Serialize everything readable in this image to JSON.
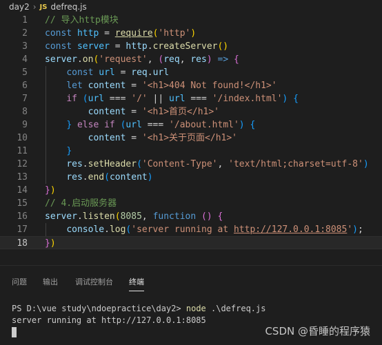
{
  "breadcrumb": {
    "folder": "day2",
    "sep": "›",
    "file_icon": "JS",
    "file": "defreq.js"
  },
  "editor": {
    "active_line": 18,
    "lines": [
      {
        "n": "1",
        "tokens": [
          {
            "t": "// 导入http模块",
            "c": "c-com"
          }
        ]
      },
      {
        "n": "2",
        "tokens": [
          {
            "t": "const ",
            "c": "c-kw"
          },
          {
            "t": "http",
            "c": "c-var"
          },
          {
            "t": " = ",
            "c": ""
          },
          {
            "t": "require",
            "c": "c-fn u"
          },
          {
            "t": "(",
            "c": "c-br1"
          },
          {
            "t": "'http'",
            "c": "c-str"
          },
          {
            "t": ")",
            "c": "c-br1"
          }
        ]
      },
      {
        "n": "3",
        "tokens": [
          {
            "t": "const ",
            "c": "c-kw"
          },
          {
            "t": "server",
            "c": "c-var"
          },
          {
            "t": " = ",
            "c": ""
          },
          {
            "t": "http",
            "c": "c-prop"
          },
          {
            "t": ".",
            "c": ""
          },
          {
            "t": "createServer",
            "c": "c-fn"
          },
          {
            "t": "()",
            "c": "c-br1"
          }
        ]
      },
      {
        "n": "4",
        "tokens": [
          {
            "t": "server",
            "c": "c-prop"
          },
          {
            "t": ".",
            "c": ""
          },
          {
            "t": "on",
            "c": "c-fn"
          },
          {
            "t": "(",
            "c": "c-br1"
          },
          {
            "t": "'request'",
            "c": "c-str"
          },
          {
            "t": ", ",
            "c": ""
          },
          {
            "t": "(",
            "c": "c-br2"
          },
          {
            "t": "req",
            "c": "c-prop"
          },
          {
            "t": ", ",
            "c": ""
          },
          {
            "t": "res",
            "c": "c-prop"
          },
          {
            "t": ")",
            "c": "c-br2"
          },
          {
            "t": " ",
            "c": ""
          },
          {
            "t": "=>",
            "c": "c-kw"
          },
          {
            "t": " ",
            "c": ""
          },
          {
            "t": "{",
            "c": "c-br2"
          }
        ]
      },
      {
        "n": "5",
        "tokens": [
          {
            "t": "    ",
            "c": ""
          },
          {
            "t": "const ",
            "c": "c-kw"
          },
          {
            "t": "url",
            "c": "c-var"
          },
          {
            "t": " = ",
            "c": ""
          },
          {
            "t": "req",
            "c": "c-prop"
          },
          {
            "t": ".",
            "c": ""
          },
          {
            "t": "url",
            "c": "c-prop"
          }
        ]
      },
      {
        "n": "6",
        "tokens": [
          {
            "t": "    ",
            "c": ""
          },
          {
            "t": "let ",
            "c": "c-kw"
          },
          {
            "t": "content",
            "c": "c-prop"
          },
          {
            "t": " = ",
            "c": ""
          },
          {
            "t": "'<h1>404 Not found!</h1>'",
            "c": "c-str"
          }
        ]
      },
      {
        "n": "7",
        "tokens": [
          {
            "t": "    ",
            "c": ""
          },
          {
            "t": "if ",
            "c": "c-ctl"
          },
          {
            "t": "(",
            "c": "c-br3"
          },
          {
            "t": "url",
            "c": "c-var"
          },
          {
            "t": " === ",
            "c": ""
          },
          {
            "t": "'/'",
            "c": "c-str"
          },
          {
            "t": " || ",
            "c": ""
          },
          {
            "t": "url",
            "c": "c-var"
          },
          {
            "t": " === ",
            "c": ""
          },
          {
            "t": "'/index.html'",
            "c": "c-str"
          },
          {
            "t": ")",
            "c": "c-br3"
          },
          {
            "t": " ",
            "c": ""
          },
          {
            "t": "{",
            "c": "c-br3"
          }
        ]
      },
      {
        "n": "8",
        "tokens": [
          {
            "t": "        ",
            "c": ""
          },
          {
            "t": "content",
            "c": "c-prop"
          },
          {
            "t": " = ",
            "c": ""
          },
          {
            "t": "'<h1>首页</h1>'",
            "c": "c-str"
          }
        ]
      },
      {
        "n": "9",
        "tokens": [
          {
            "t": "    ",
            "c": ""
          },
          {
            "t": "}",
            "c": "c-br3"
          },
          {
            "t": " ",
            "c": ""
          },
          {
            "t": "else ",
            "c": "c-ctl"
          },
          {
            "t": "if ",
            "c": "c-ctl"
          },
          {
            "t": "(",
            "c": "c-br3"
          },
          {
            "t": "url",
            "c": "c-var"
          },
          {
            "t": " === ",
            "c": ""
          },
          {
            "t": "'/about.html'",
            "c": "c-str"
          },
          {
            "t": ")",
            "c": "c-br3"
          },
          {
            "t": " ",
            "c": ""
          },
          {
            "t": "{",
            "c": "c-br3"
          }
        ]
      },
      {
        "n": "10",
        "tokens": [
          {
            "t": "        ",
            "c": ""
          },
          {
            "t": "content",
            "c": "c-prop"
          },
          {
            "t": " = ",
            "c": ""
          },
          {
            "t": "'<h1>关于页面</h1>'",
            "c": "c-str"
          }
        ]
      },
      {
        "n": "11",
        "tokens": [
          {
            "t": "    ",
            "c": ""
          },
          {
            "t": "}",
            "c": "c-br3"
          }
        ]
      },
      {
        "n": "12",
        "tokens": [
          {
            "t": "    ",
            "c": ""
          },
          {
            "t": "res",
            "c": "c-prop"
          },
          {
            "t": ".",
            "c": ""
          },
          {
            "t": "setHeader",
            "c": "c-fn"
          },
          {
            "t": "(",
            "c": "c-br3"
          },
          {
            "t": "'Content-Type'",
            "c": "c-str"
          },
          {
            "t": ", ",
            "c": ""
          },
          {
            "t": "'text/html;charset=utf-8'",
            "c": "c-str"
          },
          {
            "t": ")",
            "c": "c-br3"
          }
        ]
      },
      {
        "n": "13",
        "tokens": [
          {
            "t": "    ",
            "c": ""
          },
          {
            "t": "res",
            "c": "c-prop"
          },
          {
            "t": ".",
            "c": ""
          },
          {
            "t": "end",
            "c": "c-fn"
          },
          {
            "t": "(",
            "c": "c-br3"
          },
          {
            "t": "content",
            "c": "c-prop"
          },
          {
            "t": ")",
            "c": "c-br3"
          }
        ]
      },
      {
        "n": "14",
        "tokens": [
          {
            "t": "}",
            "c": "c-br2"
          },
          {
            "t": ")",
            "c": "c-br1"
          }
        ]
      },
      {
        "n": "15",
        "tokens": [
          {
            "t": "// 4.启动服务器",
            "c": "c-com"
          }
        ]
      },
      {
        "n": "16",
        "tokens": [
          {
            "t": "server",
            "c": "c-prop"
          },
          {
            "t": ".",
            "c": ""
          },
          {
            "t": "listen",
            "c": "c-fn"
          },
          {
            "t": "(",
            "c": "c-br1"
          },
          {
            "t": "8085",
            "c": "c-num"
          },
          {
            "t": ", ",
            "c": ""
          },
          {
            "t": "function",
            "c": "c-kw"
          },
          {
            "t": " ",
            "c": ""
          },
          {
            "t": "()",
            "c": "c-br2"
          },
          {
            "t": " ",
            "c": ""
          },
          {
            "t": "{",
            "c": "c-br2"
          }
        ]
      },
      {
        "n": "17",
        "tokens": [
          {
            "t": "    ",
            "c": ""
          },
          {
            "t": "console",
            "c": "c-prop"
          },
          {
            "t": ".",
            "c": ""
          },
          {
            "t": "log",
            "c": "c-fn"
          },
          {
            "t": "(",
            "c": "c-br3"
          },
          {
            "t": "'server running at ",
            "c": "c-str"
          },
          {
            "t": "http://127.0.0.1:8085",
            "c": "c-str u"
          },
          {
            "t": "'",
            "c": "c-str"
          },
          {
            "t": ")",
            "c": "c-br3"
          },
          {
            "t": ";",
            "c": ""
          }
        ]
      },
      {
        "n": "18",
        "tokens": [
          {
            "t": "}",
            "c": "c-br2"
          },
          {
            "t": ")",
            "c": "c-br1"
          }
        ]
      }
    ]
  },
  "panel": {
    "tabs": [
      {
        "label": "问题",
        "active": false
      },
      {
        "label": "输出",
        "active": false
      },
      {
        "label": "调试控制台",
        "active": false
      },
      {
        "label": "终端",
        "active": true
      }
    ],
    "terminal": {
      "prompt": "PS D:\\vue study\\ndoepractice\\day2> ",
      "command": "node",
      "args": " .\\defreq.js",
      "output": "server running at http://127.0.0.1:8085"
    }
  },
  "watermark": "CSDN @昏睡的程序猿"
}
